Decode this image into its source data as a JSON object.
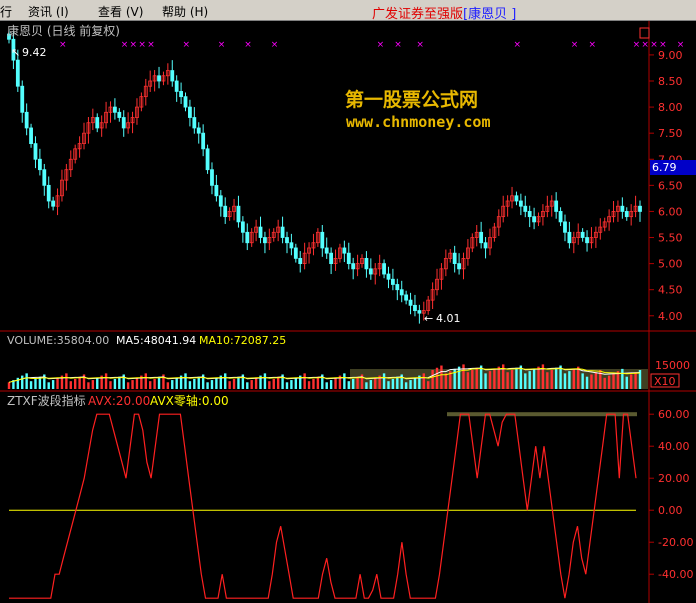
{
  "menu": {
    "items": [
      "行",
      "资讯 (I)",
      "查看 (V)",
      "帮助 (H)"
    ]
  },
  "app": {
    "title": "广发证券至强版",
    "stock": "[康恩贝   ]"
  },
  "kline": {
    "title": "康恩贝 (日线 前复权)",
    "high_label": "9.42",
    "low_label": "4.01",
    "last_price": "6.79",
    "yticks": [
      "9.00",
      "8.50",
      "8.00",
      "7.50",
      "7.00",
      "6.50",
      "6.00",
      "5.50",
      "5.00",
      "4.50",
      "4.00"
    ],
    "close": [
      9.3,
      8.9,
      8.4,
      7.9,
      7.6,
      7.3,
      7.0,
      6.8,
      6.5,
      6.2,
      6.1,
      6.3,
      6.6,
      6.8,
      7.0,
      7.2,
      7.3,
      7.5,
      7.7,
      7.8,
      7.6,
      7.7,
      7.9,
      8.0,
      7.9,
      7.8,
      7.6,
      7.7,
      7.8,
      8.0,
      8.2,
      8.4,
      8.5,
      8.6,
      8.5,
      8.6,
      8.7,
      8.5,
      8.3,
      8.2,
      8.0,
      7.8,
      7.6,
      7.5,
      7.2,
      6.8,
      6.5,
      6.3,
      6.1,
      5.9,
      6.0,
      6.1,
      5.8,
      5.6,
      5.4,
      5.6,
      5.7,
      5.5,
      5.4,
      5.5,
      5.6,
      5.7,
      5.5,
      5.4,
      5.3,
      5.1,
      5.0,
      5.2,
      5.3,
      5.4,
      5.6,
      5.3,
      5.2,
      5.0,
      5.1,
      5.3,
      5.2,
      5.0,
      4.9,
      5.0,
      5.1,
      4.9,
      4.8,
      4.9,
      5.0,
      4.8,
      4.7,
      4.6,
      4.5,
      4.4,
      4.3,
      4.2,
      4.1,
      4.05,
      4.1,
      4.3,
      4.5,
      4.7,
      4.9,
      5.1,
      5.2,
      5.0,
      4.9,
      5.1,
      5.3,
      5.5,
      5.6,
      5.4,
      5.3,
      5.5,
      5.7,
      5.9,
      6.1,
      6.2,
      6.3,
      6.2,
      6.1,
      6.0,
      5.9,
      5.8,
      5.9,
      6.0,
      6.1,
      6.2,
      6.0,
      5.8,
      5.6,
      5.4,
      5.5,
      5.6,
      5.5,
      5.4,
      5.5,
      5.6,
      5.7,
      5.8,
      5.9,
      6.0,
      6.1,
      6.0,
      5.9,
      6.0,
      6.1,
      6.0
    ],
    "signals": [
      12,
      26,
      28,
      30,
      32,
      40,
      48,
      54,
      60,
      84,
      88,
      93,
      115,
      128,
      132,
      142,
      144,
      146,
      148,
      152
    ]
  },
  "volume": {
    "label_volume": "VOLUME:35804.00",
    "label_ma5": "MA5:48041.94",
    "label_ma10": "MA10:72087.25",
    "ytick": "15000",
    "unit": "X10"
  },
  "indicator": {
    "label_name": "ZTXF波段指标",
    "label_avx": "AVX:20.00",
    "label_zero": "AVX零轴:0.00",
    "yticks": [
      "60.00",
      "40.00",
      "20.00",
      "0.00",
      "-20.00",
      "-40.00"
    ],
    "values": [
      -55,
      -55,
      -55,
      -55,
      -55,
      -55,
      -55,
      -55,
      -55,
      -55,
      -55,
      -40,
      -40,
      -30,
      -20,
      -10,
      0,
      10,
      20,
      35,
      50,
      60,
      60,
      60,
      60,
      50,
      40,
      30,
      20,
      40,
      60,
      60,
      50,
      30,
      20,
      40,
      60,
      60,
      60,
      60,
      60,
      60,
      40,
      20,
      0,
      -20,
      -40,
      -55,
      -55,
      -55,
      -55,
      -40,
      -55,
      -55,
      -55,
      -55,
      -55,
      -55,
      -55,
      -55,
      -55,
      -55,
      -55,
      -40,
      -20,
      -10,
      -25,
      -40,
      -55,
      -55,
      -55,
      -55,
      -55,
      -55,
      -55,
      -40,
      -30,
      -45,
      -55,
      -55,
      -55,
      -55,
      -55,
      -55,
      -40,
      -55,
      -55,
      -50,
      -40,
      -55,
      -55,
      -55,
      -55,
      -40,
      -20,
      -40,
      -55,
      -55,
      -55,
      -55,
      -55,
      -55,
      -55,
      -40,
      -20,
      0,
      20,
      40,
      60,
      60,
      60,
      40,
      20,
      40,
      60,
      60,
      50,
      40,
      55,
      60,
      60,
      60,
      40,
      20,
      0,
      20,
      40,
      20,
      40,
      20,
      0,
      -20,
      -40,
      -55,
      -40,
      -20,
      -10,
      -30,
      -40,
      -20,
      0,
      20,
      40,
      60,
      60,
      60,
      20,
      60,
      60,
      40,
      20
    ]
  },
  "colors": {
    "up": "#ff3030",
    "down": "#54ffff",
    "ma5": "#ffffff",
    "ma10": "#ffff00",
    "signal": "#ff00ff",
    "axis": "#b00000",
    "indicator": "#ff2020",
    "zero": "#ffff00",
    "highlight": "#5a5a30"
  },
  "watermark": {
    "cn": "第一股票公式网",
    "url": "www.chnmoney.com"
  }
}
